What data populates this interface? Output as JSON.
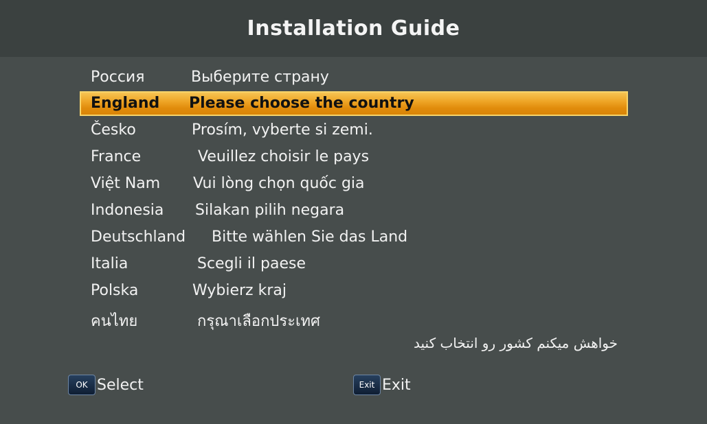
{
  "header": {
    "title": "Installation Guide"
  },
  "countries": [
    {
      "country": "Россия",
      "prompt": "Выберите страну",
      "selected": false
    },
    {
      "country": "England",
      "prompt": "Please choose the country",
      "selected": true
    },
    {
      "country": "Česko",
      "prompt": "Prosím, vyberte si zemi.",
      "selected": false
    },
    {
      "country": "France",
      "prompt": "Veuillez choisir le pays",
      "selected": false
    },
    {
      "country": "Việt Nam",
      "prompt": "Vui lòng chọn quốc gia",
      "selected": false
    },
    {
      "country": "Indonesia",
      "prompt": "Silakan pilih negara",
      "selected": false
    },
    {
      "country": "Deutschland",
      "prompt": "Bitte wählen Sie das Land",
      "selected": false
    },
    {
      "country": "Italia",
      "prompt": "Scegli il paese",
      "selected": false
    },
    {
      "country": "Polska",
      "prompt": "Wybierz kraj",
      "selected": false
    },
    {
      "country": "คนไทย",
      "prompt": "กรุณาเลือกประเทศ",
      "selected": false
    }
  ],
  "farsi_prompt": "خواهش میکنم کشور رو انتخاب کنید",
  "footer": {
    "ok_key": "OK",
    "ok_label": "Select",
    "exit_key": "Exit",
    "exit_label": "Exit"
  },
  "colors": {
    "background": "#474d4c",
    "title_bar": "#3b4140",
    "highlight": "#eea526"
  }
}
